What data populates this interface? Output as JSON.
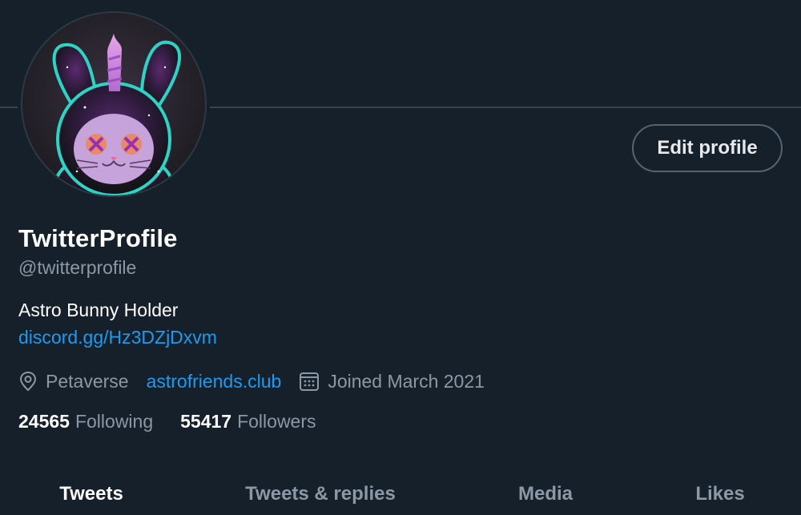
{
  "profile": {
    "display_name": "TwitterProfile",
    "handle": "@twitterprofile",
    "bio": "Astro Bunny Holder",
    "bio_link": "discord.gg/Hz3DZjDxvm",
    "avatar_icon": "astro-bunny-avatar"
  },
  "actions": {
    "edit_profile_label": "Edit profile"
  },
  "meta": {
    "location_icon": "location-pin-icon",
    "location": "Petaverse",
    "website": "astrofriends.club",
    "joined_icon": "calendar-icon",
    "joined": "Joined March 2021"
  },
  "stats": {
    "following_count": "24565",
    "following_label": "Following",
    "followers_count": "55417",
    "followers_label": "Followers"
  },
  "tabs": [
    {
      "label": "Tweets",
      "active": true
    },
    {
      "label": "Tweets & replies",
      "active": false
    },
    {
      "label": "Media",
      "active": false
    },
    {
      "label": "Likes",
      "active": false
    }
  ],
  "colors": {
    "background": "#15202b",
    "accent_link": "#1d9bf0",
    "secondary_text": "#8b98a5",
    "border": "#38444d"
  }
}
